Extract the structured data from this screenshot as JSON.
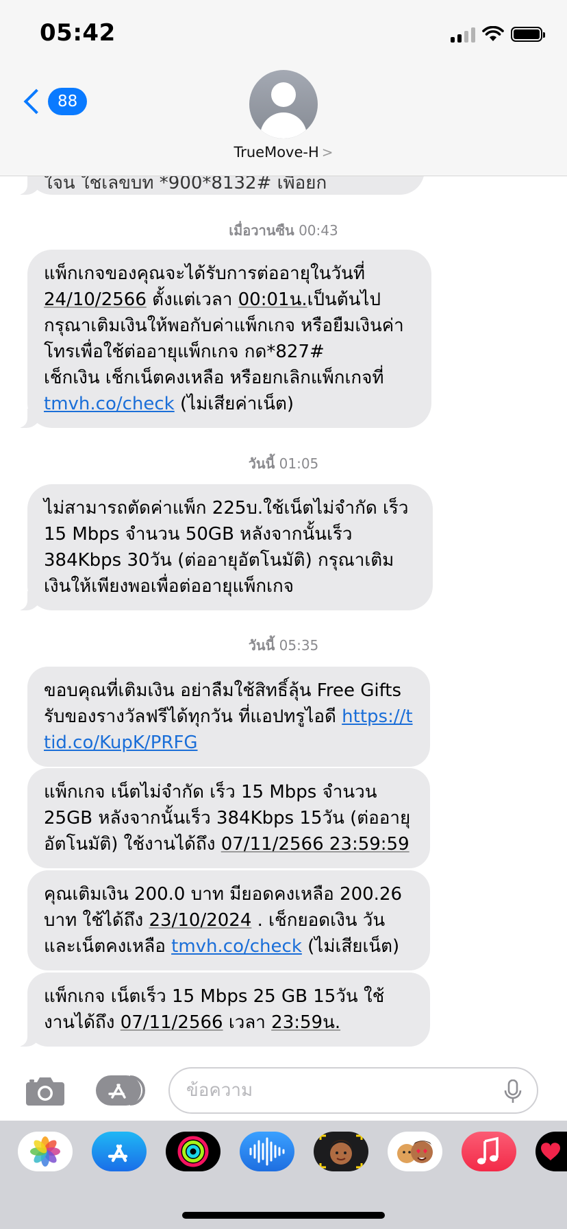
{
  "status_bar": {
    "time": "05:42"
  },
  "header": {
    "back_badge": "88",
    "contact_name": "TrueMove-H",
    "contact_chevron": ">"
  },
  "conversation": {
    "partial_message": "ใจน ใชเลขบท *900*8132# เพื่อยก",
    "timestamps": [
      {
        "day": "เมื่อวานซืน",
        "time": "00:43"
      },
      {
        "day": "วันนี้",
        "time": "01:05"
      },
      {
        "day": "วันนี้",
        "time": "05:35"
      }
    ],
    "messages": [
      {
        "line1": "แพ็กเกจของคุณจะได้รับการต่ออายุในวันที่",
        "date": "24/10/2566",
        "mid1": " ตั้งแต่เวลา ",
        "time": "00:01น.",
        "mid2": "เป็นต้นไป\nกรุณาเติมเงินให้พอกับค่าแพ็กเกจ หรือยืมเงินค่าโทรเพื่อใช้ต่ออายุแพ็กเกจ กด*827#\nเช็กเงิน เช็กเน็ตคงเหลือ หรือยกเลิกแพ็กเกจที่\n",
        "link": "tmvh.co/check",
        "end": " (ไม่เสียค่าเน็ต)"
      },
      {
        "text": "ไม่สามารถตัดค่าแพ็ก 225บ.ใช้เน็ตไม่จำกัด เร็ว 15 Mbps จำนวน 50GB หลังจากนั้นเร็ว 384Kbps 30วัน (ต่ออายุอัตโนมัติ) กรุณาเติมเงินให้เพียงพอเพื่อต่ออายุแพ็กเกจ"
      },
      {
        "text": "ขอบคุณที่เติมเงิน อย่าลืมใช้สิทธิ์ลุ้น Free Gifts รับของรางวัลฟรีได้ทุกวัน ที่แอปทรูไอดี ",
        "link": "https://ttid.co/KupK/PRFG"
      },
      {
        "text": "แพ็กเกจ เน็ตไม่จำกัด เร็ว 15 Mbps จำนวน 25GB หลังจากนั้นเร็ว 384Kbps 15วัน (ต่ออายุอัตโนมัติ) ใช้งานได้ถึง ",
        "datetime": "07/11/2566 23:59:59"
      },
      {
        "text": "คุณเติมเงิน 200.0 บาท มียอดคงเหลือ 200.26 บาท ใช้ได้ถึง ",
        "date": "23/10/2024",
        "mid": " . เช็กยอดเงิน วันและเน็ตคงเหลือ ",
        "link": "tmvh.co/check",
        "end": " (ไม่เสียเน็ต)"
      },
      {
        "text": "แพ็กเกจ เน็ตเร็ว 15 Mbps 25 GB 15วัน ใช้งานได้ถึง ",
        "date": "07/11/2566",
        "mid": " เวลา ",
        "time": "23:59น.",
        "end": ""
      }
    ]
  },
  "input": {
    "placeholder": "ข้อความ"
  },
  "app_drawer": {
    "apps": [
      "photos-icon",
      "app-store-icon",
      "activity-icon",
      "audio-icon",
      "memoji-icon",
      "memoji-stickers-icon",
      "music-icon",
      "heart-icon"
    ]
  },
  "colors": {
    "accent": "#0a7aff",
    "bubble": "#e9e9eb",
    "link": "#1a6ed8"
  }
}
